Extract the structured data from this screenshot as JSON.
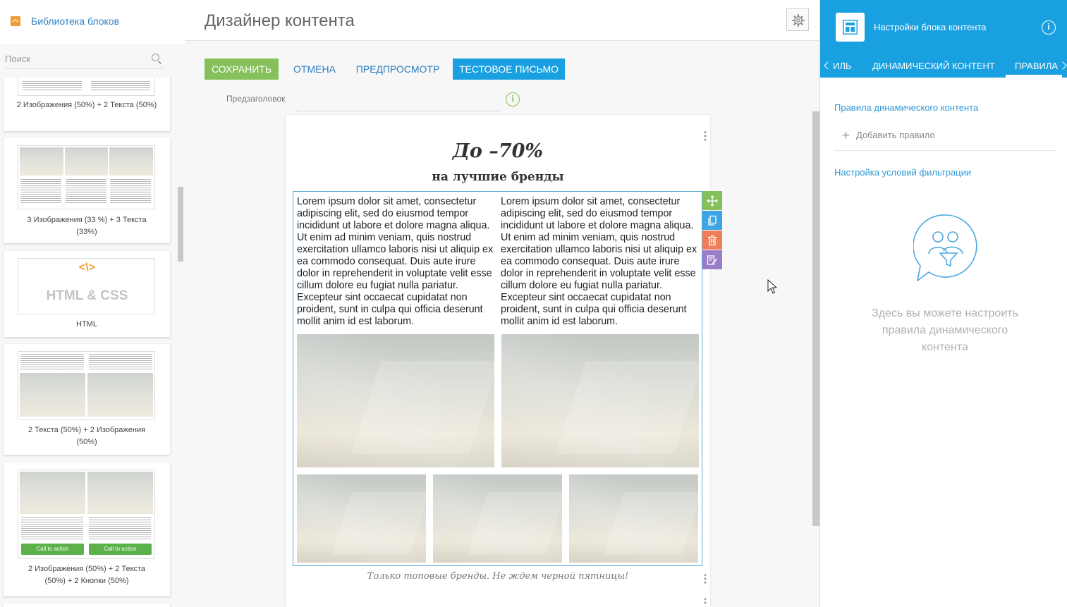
{
  "library": {
    "title": "Библиотека блоков",
    "search_placeholder": "Поиск",
    "blocks": [
      {
        "label": "2 Изображения (50%) + 2 Текста (50%)"
      },
      {
        "label": "3 Изображения (33 %) + 3 Текста (33%)"
      },
      {
        "label": "HTML",
        "thumb_code": "<\\>",
        "thumb_text": "HTML & CSS"
      },
      {
        "label": "2 Текста (50%) + 2 Изображения (50%)"
      },
      {
        "label": "2 Изображения (50%) + 2 Текста (50%) + 2 Кнопки (50%)",
        "button_label": "Call to action"
      }
    ]
  },
  "designer": {
    "title": "Дизайнер контента",
    "toolbar": {
      "save": "Сохранить",
      "cancel": "Отмена",
      "preview": "Предпросмотр",
      "test_email": "Тестовое письмо"
    },
    "preheader_label": "Предзаголовок",
    "preheader_value": "",
    "info_glyph": "i",
    "email": {
      "headline": "До –70%",
      "subheadline": "на лучшие бренды",
      "lorem_left": "Lorem ipsum dolor sit amet, consectetur adipiscing elit, sed do eiusmod tempor incididunt ut labore et dolore magna aliqua. Ut enim ad minim veniam, quis nostrud exercitation ullamco laboris nisi ut aliquip ex ea commodo consequat. Duis aute irure dolor in reprehenderit in voluptate velit esse cillum dolore eu fugiat nulla pariatur. Excepteur sint occaecat cupidatat non proident, sunt in culpa qui officia deserunt mollit anim id est laborum.",
      "lorem_right": "Lorem ipsum dolor sit amet, consectetur adipiscing elit, sed do eiusmod tempor incididunt ut labore et dolore magna aliqua. Ut enim ad minim veniam, quis nostrud exercitation ullamco laboris nisi ut aliquip ex ea commodo consequat. Duis aute irure dolor in reprehenderit in voluptate velit esse cillum dolore eu fugiat nulla pariatur. Excepteur sint occaecat cupidatat non proident, sunt in culpa qui officia deserunt mollit anim id est laborum.",
      "footer": "Только топовые бренды. Не ждем черной пятницы!"
    },
    "block_tools": [
      "move-icon",
      "copy-icon",
      "trash-icon",
      "edit-icon"
    ]
  },
  "panel": {
    "title": "Настройки блока контента",
    "info_glyph": "i",
    "tabs": [
      {
        "label": "иль",
        "active": false
      },
      {
        "label": "Динамический контент",
        "active": false
      },
      {
        "label": "Правила",
        "active": true
      }
    ],
    "rules_section_title": "Правила динамического контента",
    "add_rule": "Добавить правило",
    "filter_section_title": "Настройка условий фильтрации",
    "empty_message": "Здесь вы можете настроить правила динамического контента"
  },
  "colors": {
    "accent_blue": "#19a0e0",
    "save_green": "#85c05a",
    "link_blue": "#2d7fc1",
    "tool_move": "#85c05a",
    "tool_copy": "#3ba5e6",
    "tool_delete": "#ef7d59",
    "tool_edit": "#9b7ccb"
  }
}
